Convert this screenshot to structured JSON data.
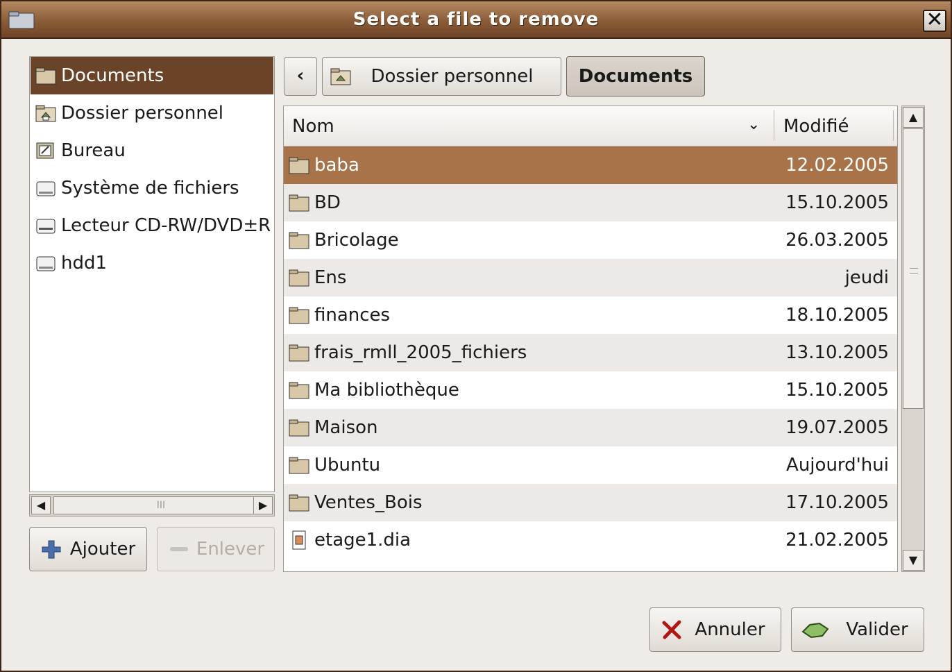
{
  "window": {
    "title": "Select a file to remove",
    "close_glyph": "✕"
  },
  "places": {
    "items": [
      {
        "label": "Documents",
        "icon": "folder-icon",
        "selected": true
      },
      {
        "label": "Dossier personnel",
        "icon": "home-folder-icon"
      },
      {
        "label": "Bureau",
        "icon": "desktop-icon"
      },
      {
        "label": "Système de fichiers",
        "icon": "drive-icon"
      },
      {
        "label": "Lecteur CD-RW/DVD±R",
        "icon": "cdrom-drive-icon"
      },
      {
        "label": "hdd1",
        "icon": "drive-icon"
      }
    ],
    "hscroll_thumb_grip": "III"
  },
  "buttons": {
    "add_label": "Ajouter",
    "remove_label": "Enlever",
    "cancel_label": "Annuler",
    "ok_label": "Valider"
  },
  "pathbar": {
    "back_glyph": "‹",
    "home_label": "Dossier personnel",
    "current_label": "Documents"
  },
  "filelist": {
    "columns": {
      "name": "Nom",
      "modified": "Modifié"
    },
    "rows": [
      {
        "name": "baba",
        "date": "12.02.2005",
        "type": "folder",
        "selected": true
      },
      {
        "name": "BD",
        "date": "15.10.2005",
        "type": "folder"
      },
      {
        "name": "Bricolage",
        "date": "26.03.2005",
        "type": "folder"
      },
      {
        "name": "Ens",
        "date": "jeudi",
        "type": "folder"
      },
      {
        "name": "finances",
        "date": "18.10.2005",
        "type": "folder"
      },
      {
        "name": "frais_rmll_2005_fichiers",
        "date": "13.10.2005",
        "type": "folder"
      },
      {
        "name": "Ma bibliothèque",
        "date": "15.10.2005",
        "type": "folder"
      },
      {
        "name": "Maison",
        "date": "19.07.2005",
        "type": "folder"
      },
      {
        "name": "Ubuntu",
        "date": "Aujourd'hui",
        "type": "folder"
      },
      {
        "name": "Ventes_Bois",
        "date": "17.10.2005",
        "type": "folder"
      },
      {
        "name": "etage1.dia",
        "date": "21.02.2005",
        "type": "file"
      }
    ]
  },
  "colors": {
    "titlebar": "#8a5c38",
    "selected_place": "#6a4328",
    "selected_row": "#a9734a"
  }
}
